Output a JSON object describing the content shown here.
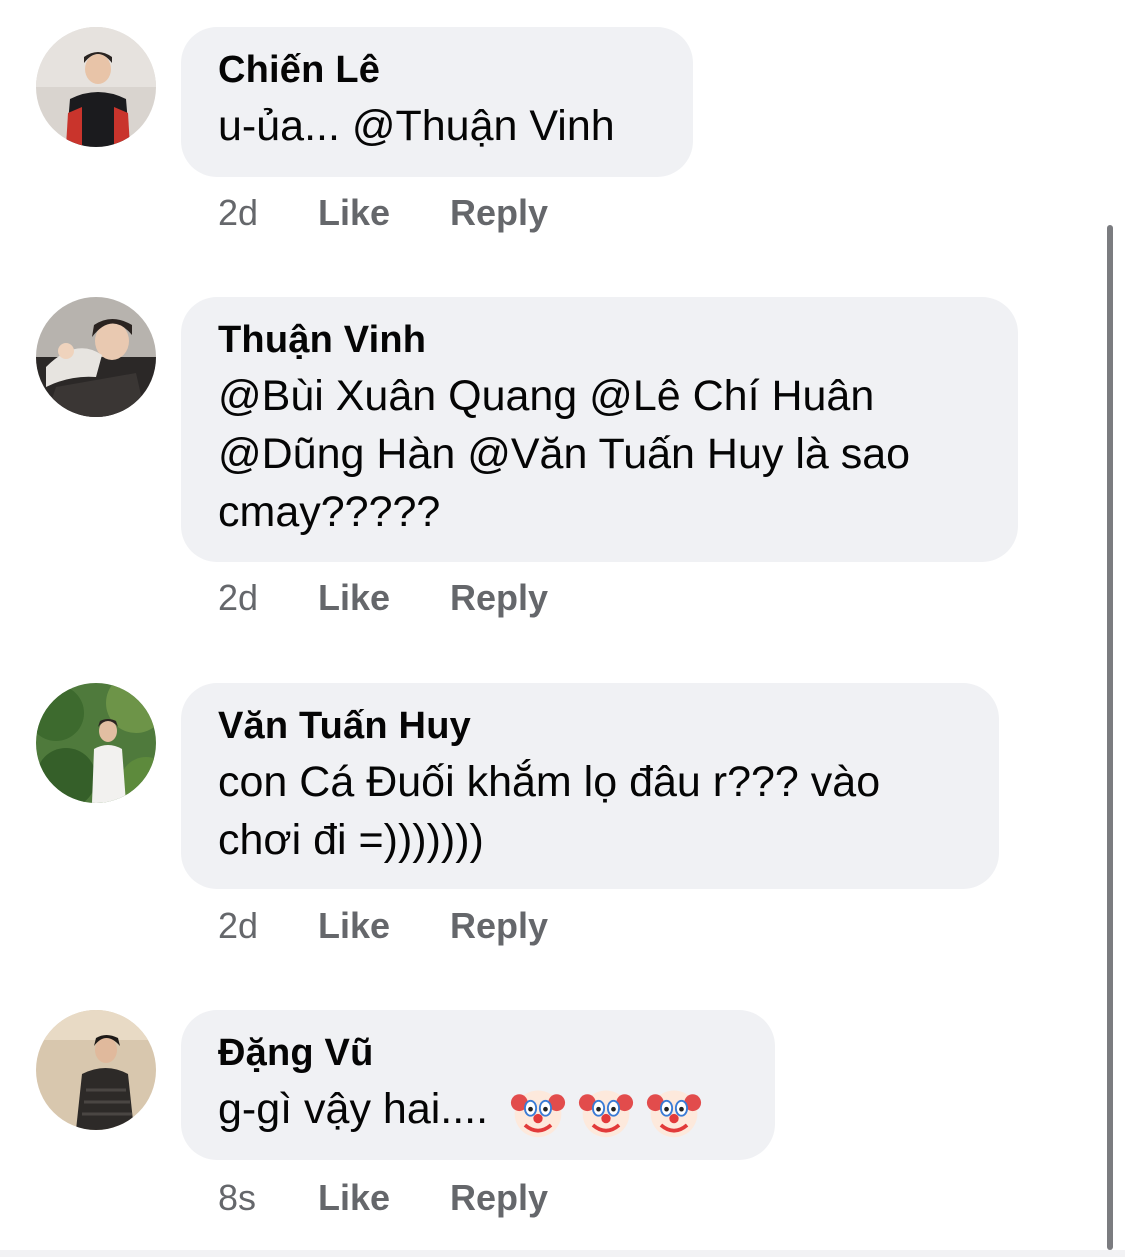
{
  "comments": [
    {
      "author": "Chiến Lê",
      "text": "u-ủa... @Thuận Vinh",
      "time": "2d",
      "like_label": "Like",
      "reply_label": "Reply"
    },
    {
      "author": "Thuận Vinh",
      "text_lines": [
        "@Bùi Xuân Quang @Lê Chí Huân",
        "@Dũng Hàn @Văn Tuấn Huy là sao",
        "cmay?????"
      ],
      "time": "2d",
      "like_label": "Like",
      "reply_label": "Reply"
    },
    {
      "author": "Văn Tuấn Huy",
      "text_lines": [
        "con Cá Đuối khắm lọ đâu r??? vào",
        "chơi đi =)))))))"
      ],
      "time": "2d",
      "like_label": "Like",
      "reply_label": "Reply"
    },
    {
      "author": "Đặng Vũ",
      "text": "g-gì vậy hai....",
      "emojis": [
        "clown-face-icon",
        "clown-face-icon",
        "clown-face-icon"
      ],
      "time": "8s",
      "like_label": "Like",
      "reply_label": "Reply"
    }
  ],
  "colors": {
    "bubble": "#f0f1f4",
    "meta_text": "#65676b",
    "author_text": "#050505",
    "scrollbar": "#7b7c80"
  }
}
